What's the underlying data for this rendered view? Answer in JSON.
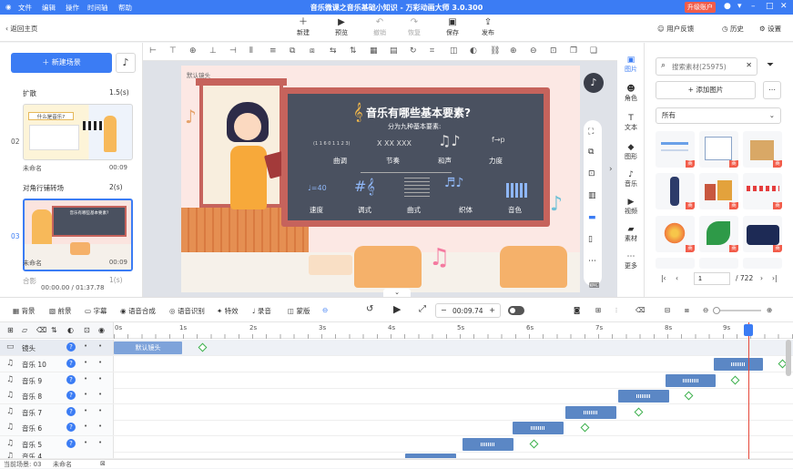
{
  "window": {
    "title": "音乐微课之音乐基础小知识 - 万彩动画大师 3.0.300",
    "menu": [
      "文件",
      "编辑",
      "操作",
      "时间轴",
      "帮助"
    ],
    "upgrade": "升级账户"
  },
  "toolbar": {
    "back": "返回主页",
    "buttons": [
      "新建",
      "预览",
      "撤销",
      "恢复",
      "保存",
      "发布"
    ],
    "right": [
      "用户反馈",
      "历史",
      "设置"
    ]
  },
  "scenes": {
    "new_scene": "新建场景",
    "items": [
      {
        "transition": "扩散",
        "duration": "1.5(s)",
        "num": "02",
        "name": "未命名",
        "time": "00:09",
        "thumb_title": "什么是音乐?"
      },
      {
        "transition": "对角行铺转场",
        "duration": "2(s)",
        "num": "03",
        "name": "未命名",
        "time": "00:09",
        "thumb_title": "音乐有哪些基本要素?"
      }
    ],
    "next_transition": "合影",
    "next_duration": "1(s)",
    "time_status": "00:00.00 / 01:37.78"
  },
  "canvas": {
    "camera_label": "默认镜头",
    "board_title": "音乐有哪些基本要素?",
    "board_subtitle": "分为九种基本要素:",
    "elements_row1": [
      "曲调",
      "节奏",
      "和声",
      "力度"
    ],
    "elements_row2": [
      "速度",
      "调式",
      "曲式",
      "织体",
      "音色"
    ],
    "tempo_mark": "♩=40",
    "dynamics_mark": "f→p"
  },
  "sidetabs": [
    "图片",
    "角色",
    "文本",
    "图形",
    "音乐",
    "视频",
    "素材",
    "更多"
  ],
  "assets": {
    "search_placeholder": "搜索素材(25975)",
    "add_image": "+ 添加图片",
    "filter": "所有",
    "page": "1",
    "total": "/ 722",
    "badge": "商"
  },
  "timeline_toolbar": {
    "buttons": [
      "背景",
      "前景",
      "字幕",
      "语音合成",
      "语音识别",
      "特效",
      "录音",
      "蒙版"
    ],
    "time": "00:09.74"
  },
  "timeline": {
    "ticks": [
      "0s",
      "1s",
      "2s",
      "3s",
      "4s",
      "5s",
      "6s",
      "7s",
      "8s",
      "9s"
    ],
    "camera_row": "镜头",
    "camera_clip": "默认镜头",
    "rows": [
      "音乐 10",
      "音乐 9",
      "音乐 8",
      "音乐 7",
      "音乐 6",
      "音乐 5",
      "音乐 4"
    ]
  },
  "status": {
    "current_scene": "当前场景: 03",
    "scene_name": "未命名"
  },
  "colors": {
    "accent": "#3b7cf4",
    "board": "#4a5160",
    "red": "#f25c4a",
    "clip": "#5b87c5"
  }
}
